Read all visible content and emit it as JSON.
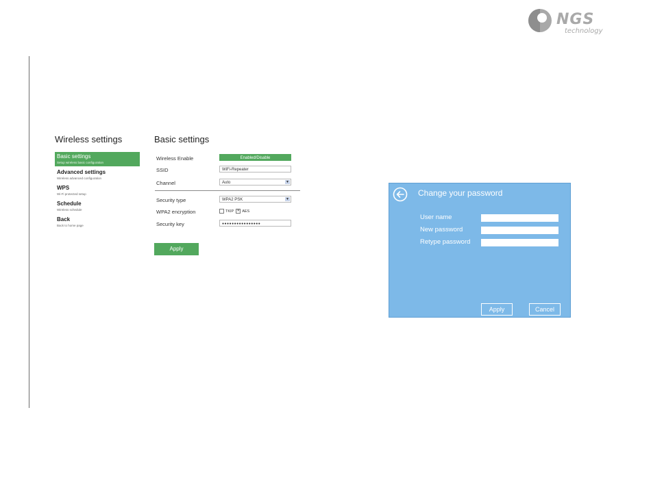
{
  "logo": {
    "brand": "NGS",
    "sub": "technology"
  },
  "left_panel": {
    "title": "Wireless settings",
    "nav": [
      {
        "label": "Basic settings",
        "desc": "Setup wireless basic configuration",
        "active": true
      },
      {
        "label": "Advanced settings",
        "desc": "Wireless advanced configuration",
        "active": false
      },
      {
        "label": "WPS",
        "desc": "Wi-Fi protected setup",
        "active": false
      },
      {
        "label": "Schedule",
        "desc": "Wireless schedule",
        "active": false
      },
      {
        "label": "Back",
        "desc": "Back to home page",
        "active": false
      }
    ]
  },
  "basic_settings": {
    "title": "Basic settings",
    "wireless_enable_label": "Wireless Enable",
    "wireless_enable_value": "Enabled/Disable",
    "ssid_label": "SSID",
    "ssid_value": "WiFi-Repeater",
    "channel_label": "Channel",
    "channel_value": "Auto",
    "security_type_label": "Security type",
    "security_type_value": "WPA2 PSK",
    "wpa2_label": "WPA2 encryption",
    "tkip_label": "TKIP",
    "aes_label": "AES",
    "security_key_label": "Security key",
    "security_key_value": "●●●●●●●●●●●●●●●●",
    "apply_label": "Apply"
  },
  "password_dialog": {
    "title": "Change your password",
    "username_label": "User name",
    "new_password_label": "New password",
    "retype_password_label": "Retype password",
    "apply_label": "Apply",
    "cancel_label": "Cancel"
  },
  "colors": {
    "accent_green": "#52a85d",
    "dialog_blue": "#7db9e8",
    "logo_gray": "#a9a9a9"
  }
}
